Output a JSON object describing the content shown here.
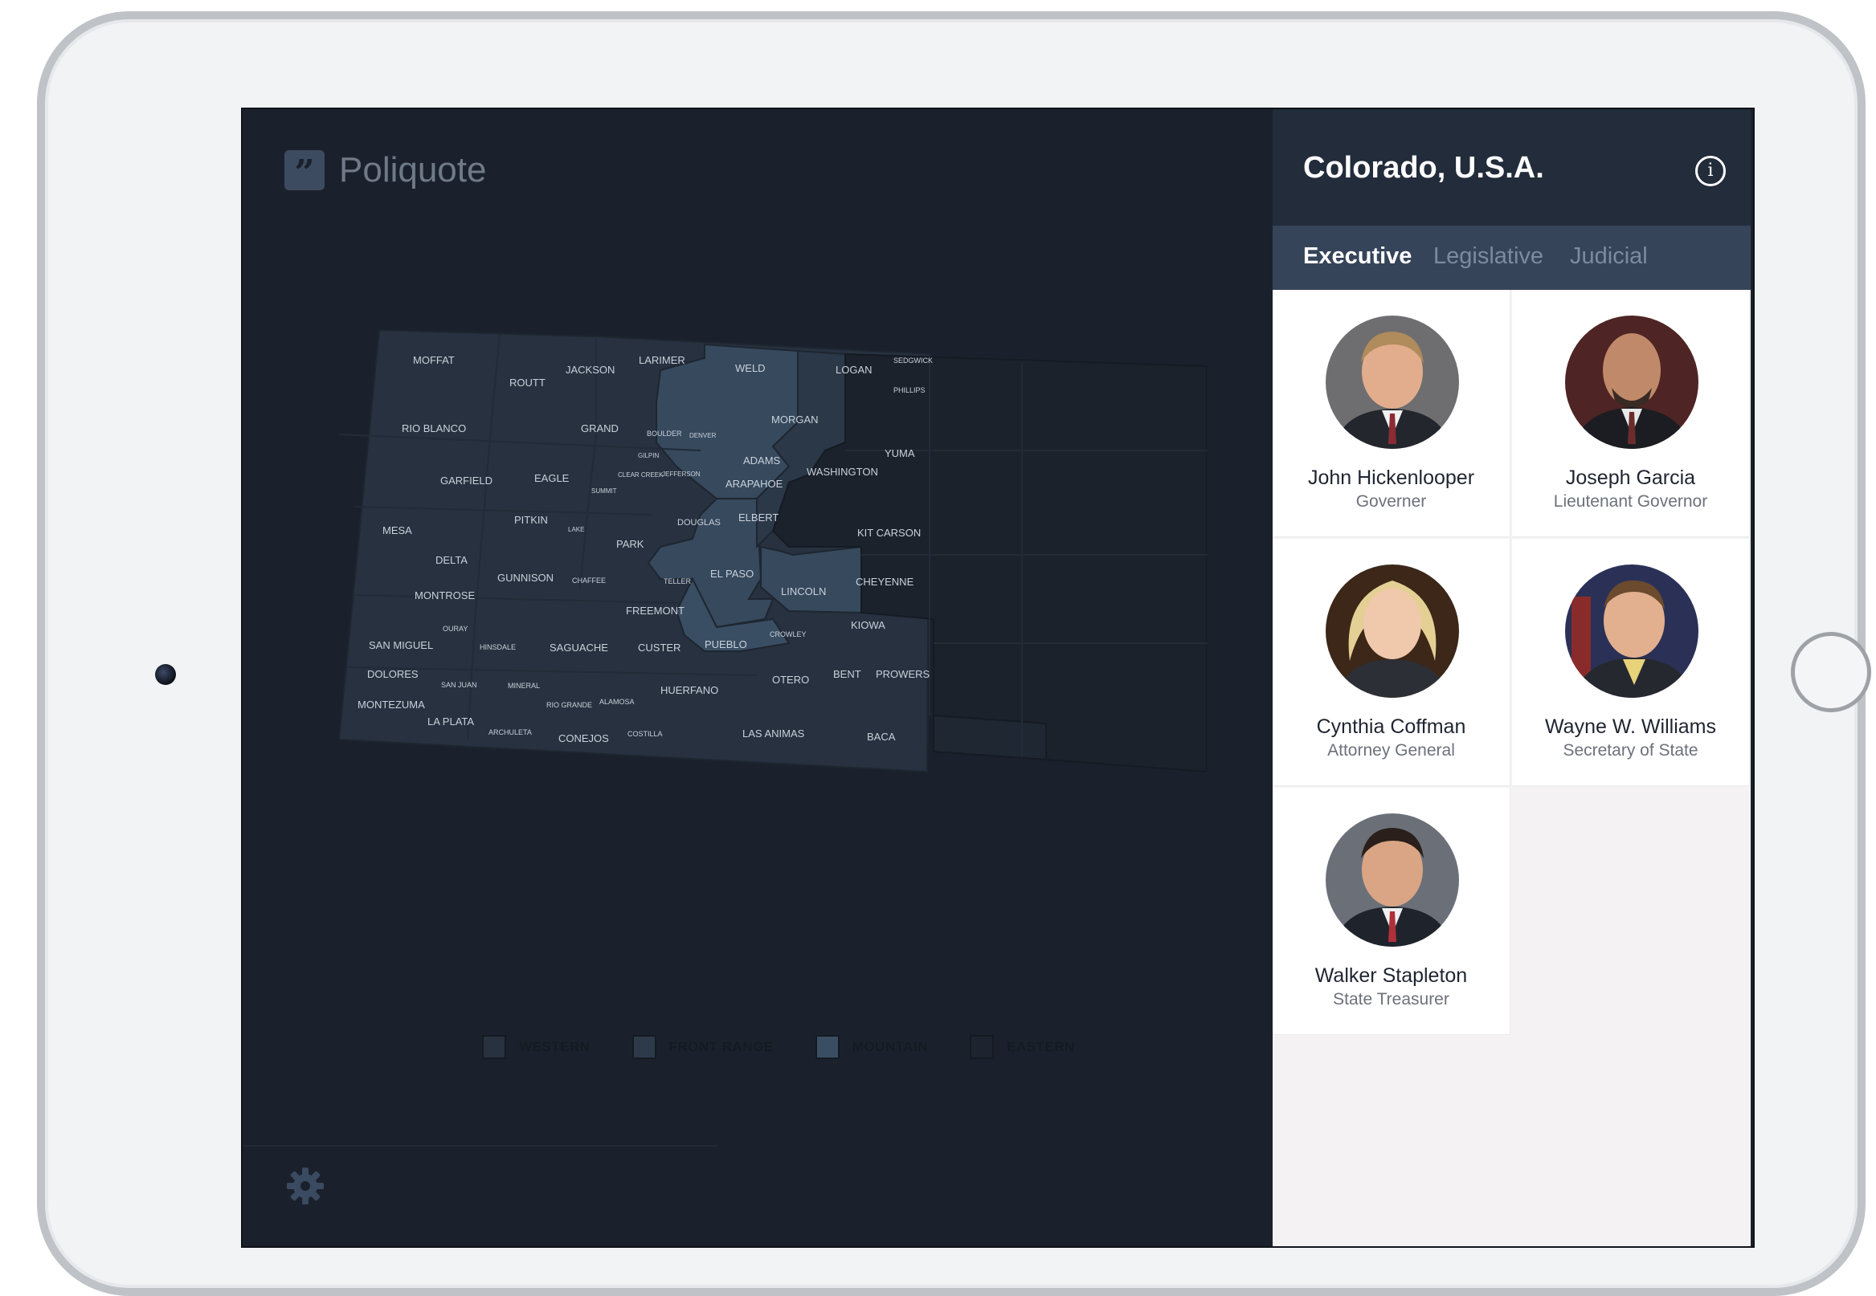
{
  "app": {
    "name": "Poliquote",
    "logo_glyph": "”"
  },
  "panel": {
    "title": "Colorado, U.S.A.",
    "info_glyph": "i",
    "tabs": [
      {
        "label": "Executive",
        "active": true
      },
      {
        "label": "Legislative",
        "active": false
      },
      {
        "label": "Judicial",
        "active": false
      }
    ],
    "officials": [
      {
        "name": "John Hickenlooper",
        "role": "Governer"
      },
      {
        "name": "Joseph Garcia",
        "role": "Lieutenant Governor"
      },
      {
        "name": "Cynthia Coffman",
        "role": "Attorney General"
      },
      {
        "name": "Wayne W. Williams",
        "role": "Secretary of State"
      },
      {
        "name": "Walker Stapleton",
        "role": "State Treasurer"
      }
    ]
  },
  "map": {
    "counties": [
      "MOFFAT",
      "ROUTT",
      "JACKSON",
      "LARIMER",
      "WELD",
      "LOGAN",
      "SEDGWICK",
      "PHILLIPS",
      "RIO BLANCO",
      "GRAND",
      "BOULDER",
      "DENVER",
      "MORGAN",
      "YUMA",
      "GILPIN",
      "CLEAR CREEK",
      "JEFFERSON",
      "ADAMS",
      "WASHINGTON",
      "GARFIELD",
      "EAGLE",
      "SUMMIT",
      "ARAPAHOE",
      "PITKIN",
      "LAKE",
      "DOUGLAS",
      "ELBERT",
      "MESA",
      "PARK",
      "KIT CARSON",
      "DELTA",
      "GUNNISON",
      "CHAFFEE",
      "TELLER",
      "EL PASO",
      "CHEYENNE",
      "LINCOLN",
      "MONTROSE",
      "FREEMONT",
      "OURAY",
      "KIOWA",
      "CROWLEY",
      "SAN MIGUEL",
      "HINSDALE",
      "SAGUACHE",
      "CUSTER",
      "PUEBLO",
      "DOLORES",
      "BENT",
      "PROWERS",
      "SAN JUAN",
      "MINERAL",
      "OTERO",
      "ALAMOSA",
      "HUERFANO",
      "RIO GRANDE",
      "MONTEZUMA",
      "LA PLATA",
      "ARCHULETA",
      "CONEJOS",
      "COSTILLA",
      "LAS ANIMAS",
      "BACA"
    ]
  },
  "legend": [
    {
      "label": "WESTERN",
      "color": "#27313f"
    },
    {
      "label": "FRONT RANGE",
      "color": "#2c3a4a"
    },
    {
      "label": "MOUNTAIN",
      "color": "#3a4e63"
    },
    {
      "label": "EASTERN",
      "color": "#1d242f"
    }
  ],
  "colors": {
    "western": "#27313f",
    "mountain": "#36495d",
    "front_range": "#2b3848",
    "eastern": "#1b222c",
    "header_bg": "#222c3b",
    "tabs_bg": "#36445a",
    "screen_bg": "#1b212c"
  },
  "icons": [
    "logo-quote-icon",
    "info-icon",
    "gear-icon"
  ]
}
